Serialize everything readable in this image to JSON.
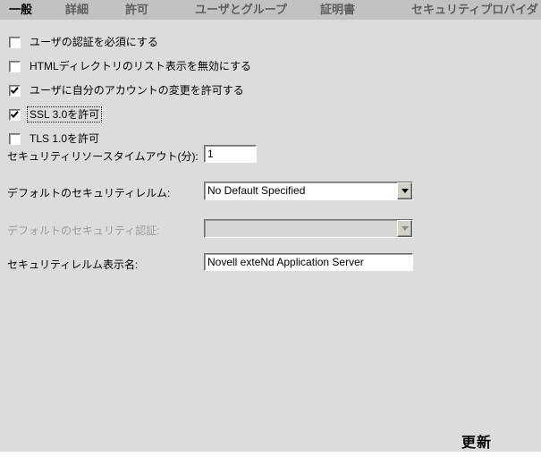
{
  "tabs": [
    {
      "label": "一般",
      "active": true
    },
    {
      "label": "詳細",
      "active": false
    },
    {
      "label": "許可",
      "active": false
    },
    {
      "label": "ユーザとグループ",
      "active": false
    },
    {
      "label": "証明書",
      "active": false
    },
    {
      "label": "セキュリティプロバイダ",
      "active": false
    }
  ],
  "checkboxes": [
    {
      "label": "ユーザの認証を必須にする",
      "checked": false,
      "focused": false
    },
    {
      "label": "HTMLディレクトリのリスト表示を無効にする",
      "checked": false,
      "focused": false
    },
    {
      "label": "ユーザに自分のアカウントの変更を許可する",
      "checked": true,
      "focused": false
    },
    {
      "label": "SSL 3.0を許可",
      "checked": true,
      "focused": true
    },
    {
      "label": "TLS 1.0を許可",
      "checked": false,
      "focused": false
    }
  ],
  "fields": {
    "timeout": {
      "label": "セキュリティリソースタイムアウト(分):",
      "value": "1"
    },
    "default_realm": {
      "label": "デフォルトのセキュリティレルム:",
      "value": "No Default Specified",
      "disabled": false
    },
    "default_auth": {
      "label": "デフォルトのセキュリティ認証:",
      "value": "",
      "disabled": true
    },
    "realm_display_name": {
      "label": "セキュリティレルム表示名:",
      "value": "Novell exteNd Application Server"
    }
  },
  "update_button": {
    "label": "更新"
  },
  "colors": {
    "body_bg": "#dcdcdc",
    "tabbar_bg": "#c2c2c2",
    "inactive_tab_text": "#5e5e5e",
    "active_tab_text": "#000000",
    "disabled_text": "#9b9b9b",
    "field_bg": "#ffffff"
  }
}
